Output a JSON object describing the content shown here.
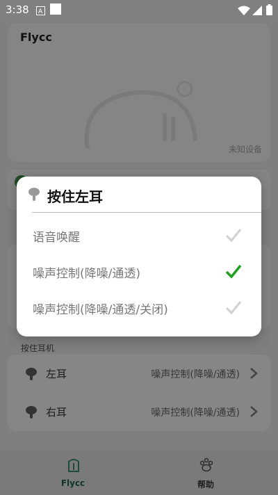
{
  "status_bar": {
    "time": "3:38"
  },
  "device": {
    "title": "Flycc",
    "status": "未知设备"
  },
  "section_press": {
    "label": "按住耳机"
  },
  "list": [
    {
      "label": "左耳",
      "value": "噪声控制(降噪/通透)",
      "icon": "earbud-left-icon"
    },
    {
      "label": "右耳",
      "value": "噪声控制(降噪/通透)",
      "icon": "earbud-right-icon"
    }
  ],
  "nav": [
    {
      "label": "Flycc",
      "icon": "flycc-tab-icon",
      "active": true
    },
    {
      "label": "帮助",
      "icon": "paw-help-icon",
      "active": false
    }
  ],
  "dialog": {
    "title": "按住左耳",
    "options": [
      {
        "label": "语音唤醒",
        "checked": false
      },
      {
        "label": "噪声控制(降噪/通透)",
        "checked": true
      },
      {
        "label": "噪声控制(降噪/通透/关闭)",
        "checked": false
      }
    ]
  },
  "colors": {
    "accent": "#2e7d32",
    "check_active": "#1aa31a",
    "check_inactive": "#d0d0d0"
  }
}
